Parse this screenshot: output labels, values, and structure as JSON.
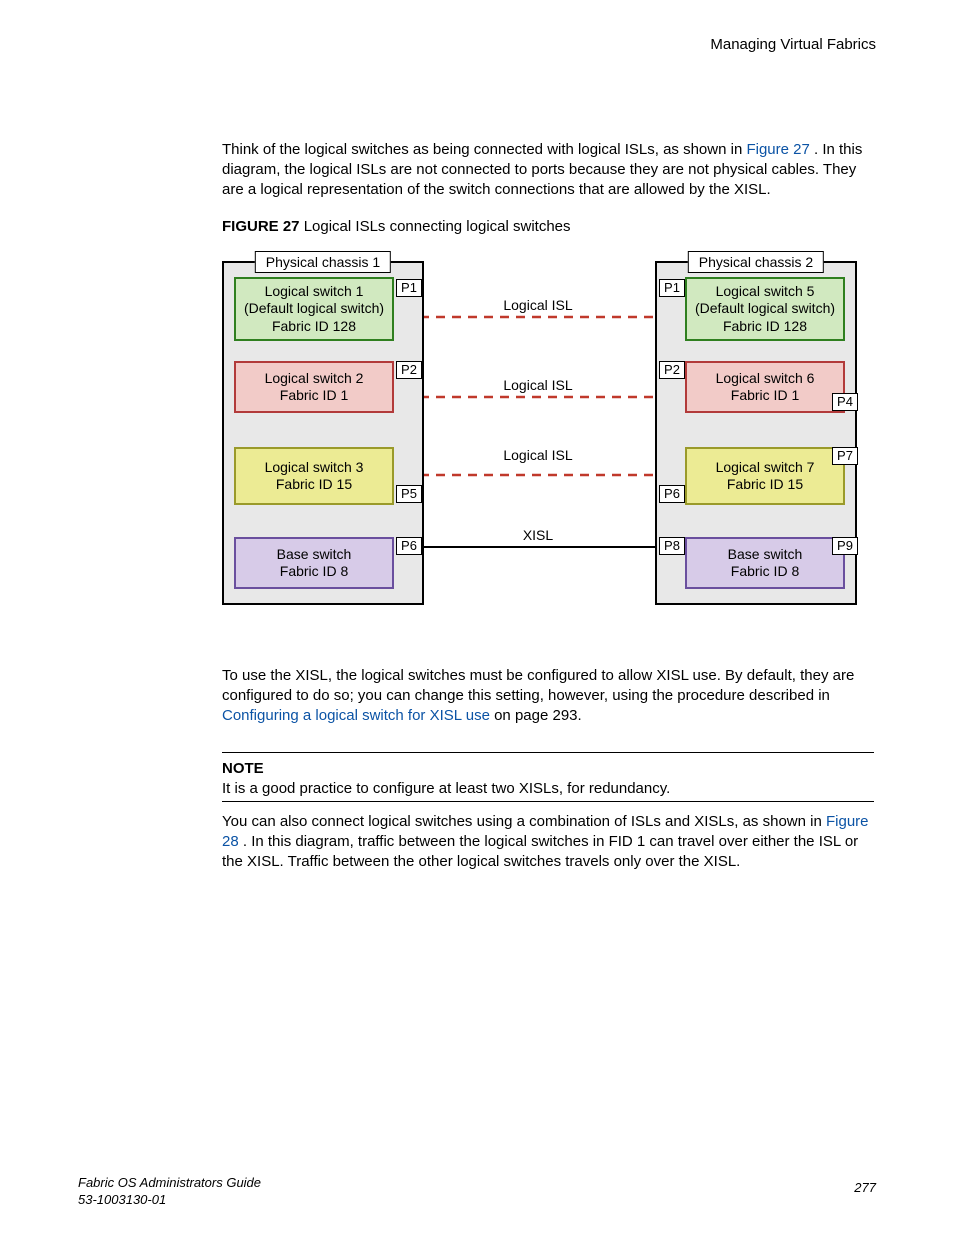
{
  "header": {
    "title": "Managing Virtual Fabrics"
  },
  "para1": {
    "pre": "Think of the logical switches as being connected with logical ISLs, as shown in ",
    "link": "Figure 27 ",
    "post": ". In this diagram, the logical ISLs are not connected to ports because they are not physical cables. They are a logical representation of the switch connections that are allowed by the XISL."
  },
  "fig27": {
    "bold": "FIGURE 27",
    "rest": " Logical ISLs connecting logical switches"
  },
  "diagram": {
    "chassis1": "Physical chassis 1",
    "chassis2": "Physical chassis 2",
    "ls1": {
      "l1": "Logical switch 1",
      "l2": "(Default logical switch)",
      "l3": "Fabric ID 128"
    },
    "ls2": {
      "l1": "Logical switch 2",
      "l2": "Fabric ID 1"
    },
    "ls3": {
      "l1": "Logical switch 3",
      "l2": "Fabric ID 15"
    },
    "ls4": {
      "l1": "Base switch",
      "l2": "Fabric ID 8"
    },
    "ls5": {
      "l1": "Logical switch 5",
      "l2": "(Default logical switch)",
      "l3": "Fabric ID 128"
    },
    "ls6": {
      "l1": "Logical switch 6",
      "l2": "Fabric ID 1"
    },
    "ls7": {
      "l1": "Logical switch 7",
      "l2": "Fabric ID 15"
    },
    "ls8": {
      "l1": "Base switch",
      "l2": "Fabric ID 8"
    },
    "labels": {
      "lisl": "Logical ISL",
      "xisl": "XISL"
    },
    "ports": {
      "p1": "P1",
      "p2": "P2",
      "p4": "P4",
      "p5": "P5",
      "p6": "P6",
      "p7": "P7",
      "p8": "P8",
      "p9": "P9"
    }
  },
  "para2": {
    "pre": "To use the XISL, the logical switches must be configured to allow XISL use. By default, they are configured to do so; you can change this setting, however, using the procedure described in ",
    "link": "Configuring a logical switch for XISL use",
    "post": " on page 293."
  },
  "note": {
    "label": "NOTE",
    "text": "It is a good practice to configure at least two XISLs, for redundancy."
  },
  "para3": {
    "pre": "You can also connect logical switches using a combination of ISLs and XISLs, as shown in ",
    "link": "Figure 28 ",
    "post": ". In this diagram, traffic between the logical switches in FID 1 can travel over either the ISL or the XISL. Traffic between the other logical switches travels only over the XISL."
  },
  "footer": {
    "guide": "Fabric OS Administrators Guide",
    "docnum": "53-1003130-01",
    "page": "277"
  }
}
